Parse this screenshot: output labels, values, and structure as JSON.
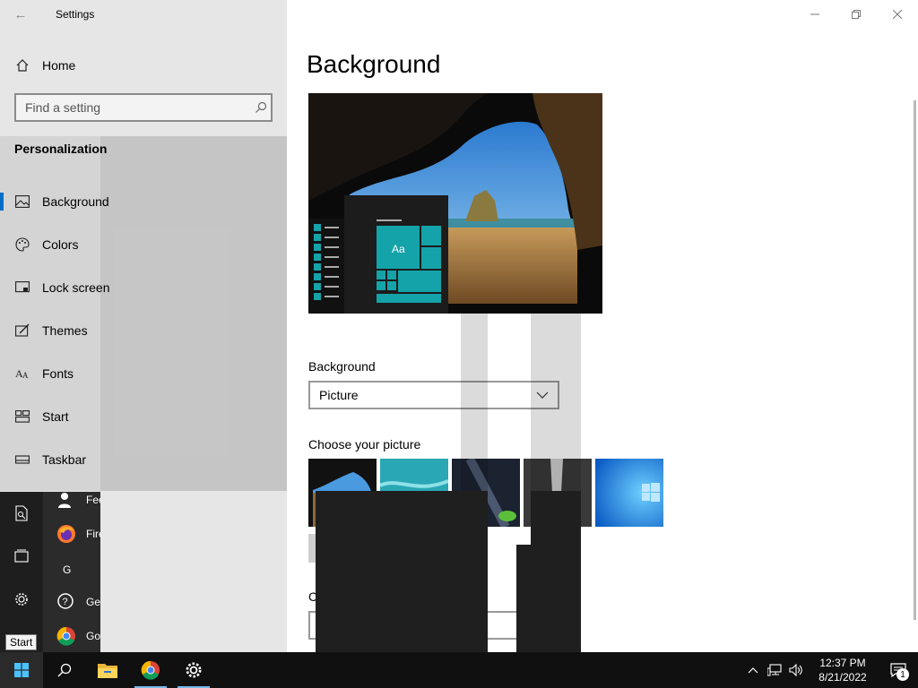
{
  "window": {
    "title": "Settings",
    "back_glyph": "←"
  },
  "sidebar": {
    "home_label": "Home",
    "search_placeholder": "Find a setting",
    "section_heading": "Personalization",
    "items": [
      {
        "label": "Background",
        "icon": "picture-icon",
        "active": true
      },
      {
        "label": "Colors",
        "icon": "palette-icon",
        "active": false
      },
      {
        "label": "Lock screen",
        "icon": "lock-screen-icon",
        "active": false
      },
      {
        "label": "Themes",
        "icon": "themes-icon",
        "active": false
      },
      {
        "label": "Fonts",
        "icon": "fonts-icon",
        "active": false
      },
      {
        "label": "Start",
        "icon": "start-icon",
        "active": false
      },
      {
        "label": "Taskbar",
        "icon": "taskbar-icon",
        "active": false
      }
    ]
  },
  "main": {
    "page_title": "Background",
    "preview_tile_text": "Aa",
    "background_label": "Background",
    "background_value": "Picture",
    "choose_picture_label": "Choose your picture",
    "choose_fit_label_partial": "C",
    "thumbnails": [
      "cave-beach",
      "aerial-ocean",
      "night-sky-tent",
      "waterfall-rock",
      "windows-logo-blue"
    ]
  },
  "start_menu": {
    "letter_header": "G",
    "apps": [
      {
        "label": "Fee",
        "icon": "feedback-hub-icon"
      },
      {
        "label": "Fire",
        "icon": "firefox-icon"
      },
      {
        "label": "Get",
        "icon": "get-help-icon"
      },
      {
        "label": "Go",
        "icon": "chrome-icon"
      }
    ],
    "tooltip": "Start"
  },
  "taskbar": {
    "time": "12:37 PM",
    "date": "8/21/2022",
    "notification_count": "1",
    "accent_color": "#0078d7"
  }
}
